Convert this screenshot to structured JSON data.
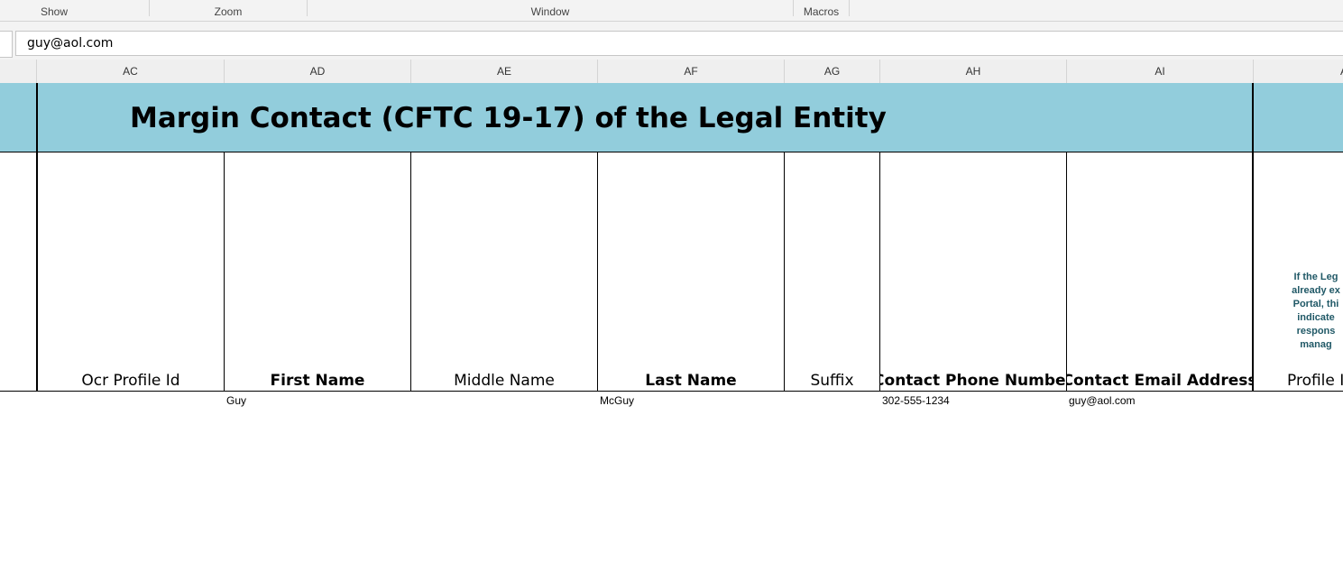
{
  "ribbon": {
    "groups": [
      {
        "label": "Show"
      },
      {
        "label": "Zoom"
      },
      {
        "label": "Window"
      },
      {
        "label": "Macros"
      }
    ]
  },
  "formula_bar": {
    "value": "guy@aol.com"
  },
  "columns": [
    "AC",
    "AD",
    "AE",
    "AF",
    "AG",
    "AH",
    "AI",
    "A"
  ],
  "section_title": "Margin Contact (CFTC 19-17) of the Legal Entity",
  "field_headers": [
    {
      "label": "Ocr Profile Id",
      "bold": false
    },
    {
      "label": "First Name",
      "bold": true
    },
    {
      "label": "Middle Name",
      "bold": false
    },
    {
      "label": "Last Name",
      "bold": true
    },
    {
      "label": "Suffix",
      "bold": false
    },
    {
      "label": "Contact Phone Number",
      "bold": true
    },
    {
      "label": "Contact Email Address",
      "bold": true
    },
    {
      "label": "Profile I",
      "bold": false
    }
  ],
  "row": {
    "first_name": "Guy",
    "last_name": "McGuy",
    "phone": "302-555-1234",
    "email": "guy@aol.com"
  },
  "side_note": [
    "If the Leg",
    "already ex",
    "Portal, thi",
    "indicate",
    "respons",
    "manag"
  ],
  "colors": {
    "band": "#92cddc",
    "note_text": "#215967"
  }
}
